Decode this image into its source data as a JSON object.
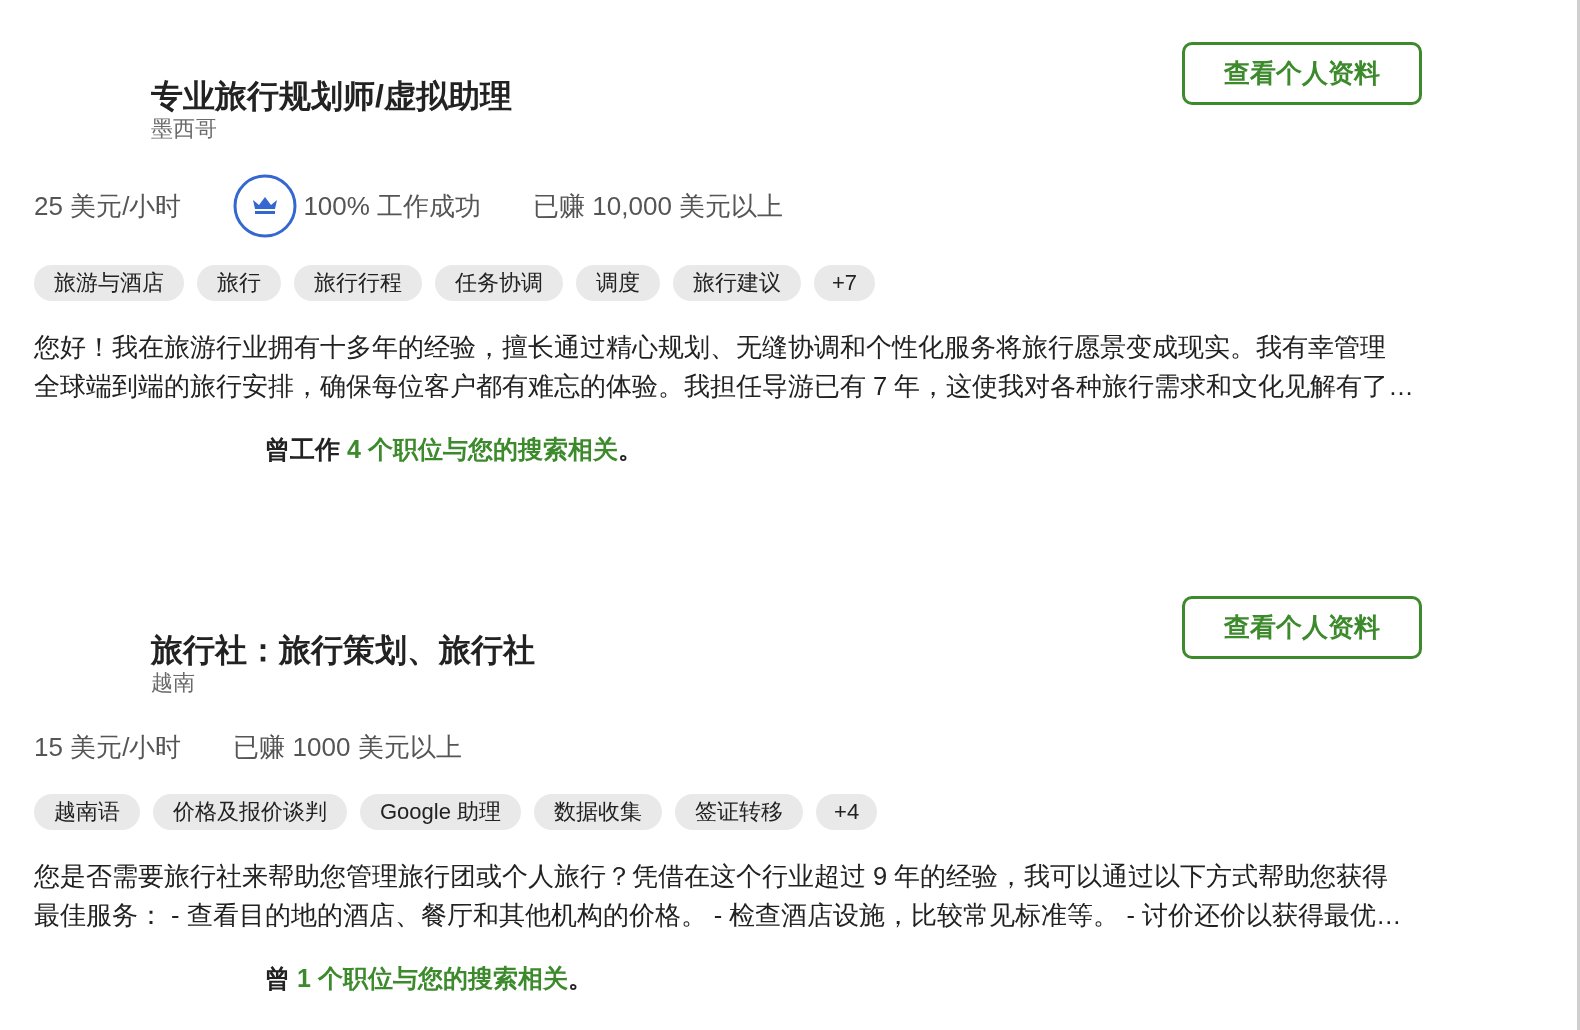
{
  "profiles": [
    {
      "title": "专业旅行规划师/虚拟助理",
      "location": "墨西哥",
      "button": "查看个人资料",
      "stats": [
        {
          "kind": "rate",
          "text": "25 美元/小时"
        },
        {
          "kind": "job_success",
          "text": "100% 工作成功"
        },
        {
          "kind": "earnings",
          "text": "已赚 10,000 美元以上"
        }
      ],
      "skills": [
        "旅游与酒店",
        "旅行",
        "旅行行程",
        "任务协调",
        "调度",
        "旅行建议"
      ],
      "more_skills": "+7",
      "description": [
        "您好！我在旅游行业拥有十多年的经验，擅长通过精心规划、无缝协调和个性化服务将旅行愿景变成现实。我有幸管理",
        "全球端到端的旅行安排，确保每位客户都有难忘的体验。我担任导游已有 7 年，这使我对各种旅行需求和文化见解有了…"
      ],
      "related": {
        "before": "曾工作",
        "link": "4 个职位与您的搜索相关",
        "after": "。"
      }
    },
    {
      "title": "旅行社：旅行策划、旅行社",
      "location": "越南",
      "button": "查看个人资料",
      "stats": [
        {
          "kind": "rate",
          "text": "15 美元/小时"
        },
        {
          "kind": "earnings",
          "text": "已赚 1000 美元以上"
        }
      ],
      "skills": [
        "越南语",
        "价格及报价谈判",
        "Google 助理",
        "数据收集",
        "签证转移"
      ],
      "more_skills": "+4",
      "description": [
        "您是否需要旅行社来帮助您管理旅行团或个人旅行？凭借在这个行业超过 9 年的经验，我可以通过以下方式帮助您获得",
        "最佳服务： - 查看目的地的酒店、餐厅和其他机构的价格。 - 检查酒店设施，比较常见标准等。 - 讨价还价以获得最优…"
      ],
      "related": {
        "before": "曾",
        "link": "1 个职位与您的搜索相关",
        "after": "。"
      }
    }
  ]
}
